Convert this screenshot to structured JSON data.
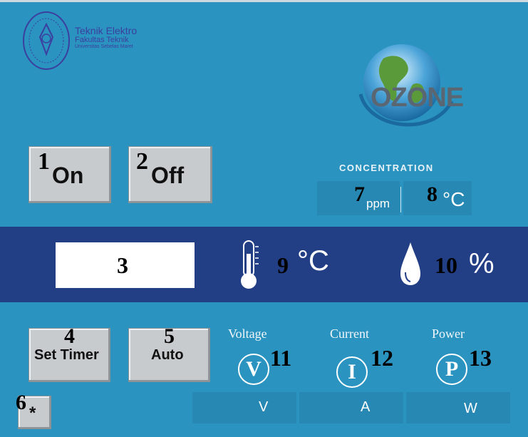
{
  "header": {
    "logo_line1": "Teknik Elektro",
    "logo_line2": "Fakultas Teknik",
    "logo_line3": "Universitas Sebelas Maret",
    "ozone_label": "OZONE"
  },
  "buttons": {
    "on": {
      "number": "1",
      "label": "On"
    },
    "off": {
      "number": "2",
      "label": "Off"
    },
    "set_timer": {
      "number": "4",
      "label": "Set Timer"
    },
    "auto": {
      "number": "5",
      "label": "Auto"
    },
    "star": {
      "number": "6",
      "label": "*"
    }
  },
  "concentration": {
    "title": "CONCENTRATION",
    "ppm_number": "7",
    "ppm_unit": "ppm",
    "temp_number": "8",
    "temp_unit": "°C"
  },
  "display_band": {
    "textbox_number": "3",
    "temperature_number": "9",
    "temperature_unit": "°C",
    "humidity_number": "10",
    "humidity_unit": "%"
  },
  "meters": [
    {
      "label": "Voltage",
      "symbol": "V",
      "number": "11",
      "unit": "V"
    },
    {
      "label": "Current",
      "symbol": "I",
      "number": "12",
      "unit": "A"
    },
    {
      "label": "Power",
      "symbol": "P",
      "number": "13",
      "unit": "W"
    }
  ],
  "colors": {
    "background": "#2b93bf",
    "band": "#223f86",
    "button": "#c8cbcd"
  }
}
